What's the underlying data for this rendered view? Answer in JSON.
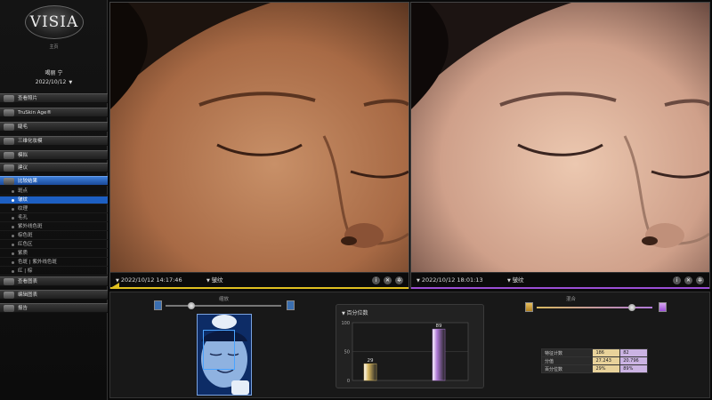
{
  "app": {
    "logo": "VISIA",
    "subtitle": "主页",
    "patient_name": "喝丽 宁",
    "session_date": "2022/10/12"
  },
  "sidebar": {
    "items": [
      {
        "label": "查看照片",
        "active": false
      },
      {
        "label": "TruSkin Age®",
        "active": false
      },
      {
        "label": "睫毛",
        "active": false
      },
      {
        "label": "三维化妆模",
        "active": false
      },
      {
        "label": "模拟",
        "active": false
      },
      {
        "label": "建议",
        "active": false
      },
      {
        "label": "比较结果",
        "active": true
      }
    ],
    "subitems": [
      {
        "label": "斑点",
        "active": false
      },
      {
        "label": "皱纹",
        "active": true
      },
      {
        "label": "纹理",
        "active": false
      },
      {
        "label": "毛孔",
        "active": false
      },
      {
        "label": "紫外线色斑",
        "active": false
      },
      {
        "label": "棕色斑",
        "active": false
      },
      {
        "label": "红色区",
        "active": false
      },
      {
        "label": "紫质",
        "active": false
      },
      {
        "label": "色斑 | 紫外线色斑",
        "active": false
      },
      {
        "label": "红 | 棕",
        "active": false
      }
    ],
    "bottom_items": [
      {
        "label": "查看图表"
      },
      {
        "label": "编辑图表"
      },
      {
        "label": "报告"
      }
    ]
  },
  "left_pane": {
    "datetime": "2022/10/12 14:17:46",
    "mode": "皱纹",
    "accent": "#e0c020"
  },
  "right_pane": {
    "datetime": "2022/10/12 18:01:13",
    "mode": "皱纹",
    "accent": "#9b4fd6"
  },
  "bottom": {
    "zoom_label": "缩放",
    "blend_label": "混合",
    "blend_level": 0.82,
    "zoom_level": 0.22,
    "percentile_title": "百分位数"
  },
  "chart_data": {
    "type": "bar",
    "title": "百分位数",
    "categories": [
      "1",
      "2"
    ],
    "values": [
      29,
      89
    ],
    "ylim": [
      0,
      100
    ],
    "yticks": [
      0,
      50,
      100
    ],
    "colors": [
      "#d8b860",
      "#b07ad8"
    ],
    "grid": true
  },
  "score_table": {
    "rows": [
      {
        "label": "特征计数",
        "a": "186",
        "b": "82"
      },
      {
        "label": "分值",
        "a": "27.243",
        "b": "20.796"
      },
      {
        "label": "百分位数",
        "a": "29%",
        "b": "89%"
      }
    ]
  }
}
